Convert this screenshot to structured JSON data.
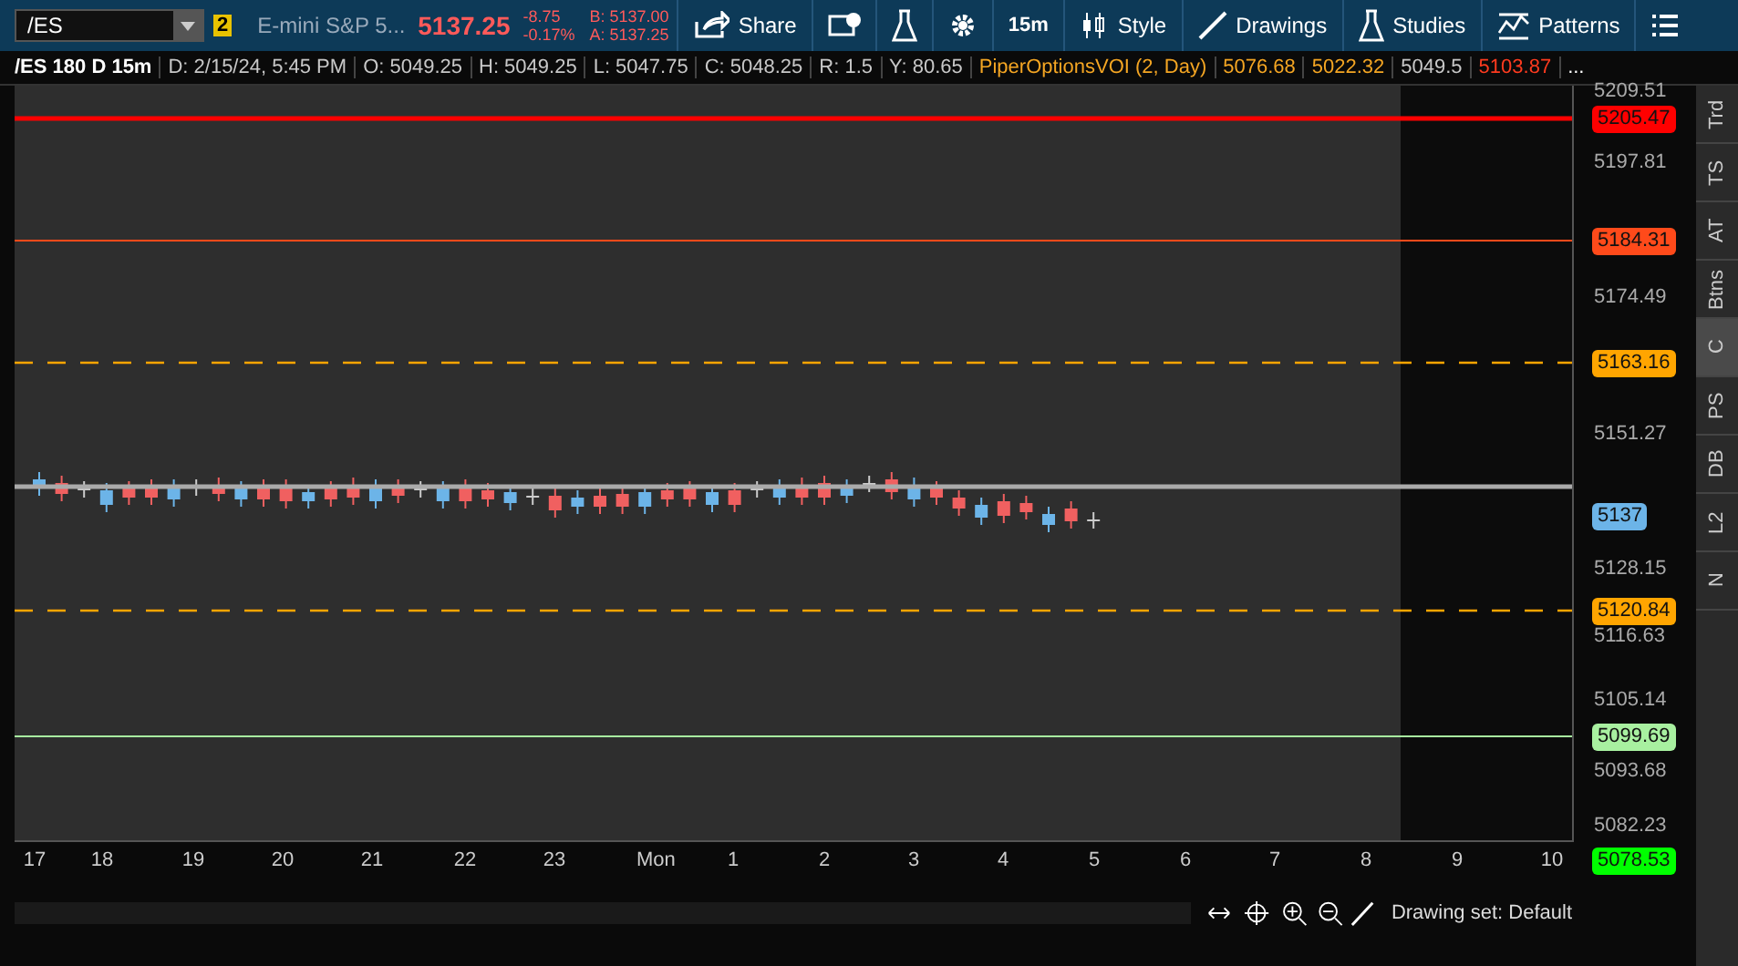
{
  "toolbar": {
    "symbol": "/ES",
    "link_badge": "2",
    "description": "E-mini S&P 5...",
    "last_price": "5137.25",
    "change": "-8.75",
    "change_pct": "-0.17%",
    "bid": "B: 5137.00",
    "ask": "A: 5137.25",
    "buttons": [
      {
        "kind": "share",
        "label": "Share"
      },
      {
        "kind": "monitor"
      },
      {
        "kind": "flask"
      },
      {
        "kind": "gear"
      },
      {
        "kind": "text",
        "label": "15m"
      },
      {
        "kind": "style",
        "label": "Style"
      },
      {
        "kind": "drawings",
        "label": "Drawings"
      },
      {
        "kind": "studies",
        "label": "Studies"
      },
      {
        "kind": "patterns",
        "label": "Patterns"
      },
      {
        "kind": "menu"
      }
    ]
  },
  "info_bar": {
    "title": "/ES 180 D 15m",
    "fields": [
      {
        "text": "D: 2/15/24, 5:45 PM",
        "color": "#c8c8c8"
      },
      {
        "text": "O: 5049.25",
        "color": "#c8c8c8"
      },
      {
        "text": "H: 5049.25",
        "color": "#c8c8c8"
      },
      {
        "text": "L: 5047.75",
        "color": "#c8c8c8"
      },
      {
        "text": "C: 5048.25",
        "color": "#c8c8c8"
      },
      {
        "text": "R: 1.5",
        "color": "#c8c8c8"
      },
      {
        "text": "Y: 80.65",
        "color": "#c8c8c8"
      },
      {
        "text": "PiperOptionsVOI (2, Day)",
        "color": "#f5a623"
      },
      {
        "text": "5076.68",
        "color": "#f5a623"
      },
      {
        "text": "5022.32",
        "color": "#f5a623"
      },
      {
        "text": "5049.5",
        "color": "#c8c8c8"
      },
      {
        "text": "5103.87",
        "color": "#ff3b1f"
      },
      {
        "text": "...",
        "color": "#ffffff"
      }
    ]
  },
  "price_axis": [
    "5209.51",
    "5197.81",
    "5174.49",
    "5151.27",
    "5128.15",
    "5116.63",
    "5105.14",
    "5093.68",
    "5082.23"
  ],
  "price_lines": [
    {
      "label": "5205.47",
      "color": "#ff0000",
      "kind": "solid"
    },
    {
      "label": "5184.31",
      "color": "#ff4a1a",
      "kind": "thin"
    },
    {
      "label": "5163.16",
      "color": "#ffa500",
      "kind": "dashed"
    },
    {
      "label": "5137",
      "color": "#6cb4e8",
      "kind": "price"
    },
    {
      "label": "5120.84",
      "color": "#ffa500",
      "kind": "dashed"
    },
    {
      "label": "5099.69",
      "color": "#a8f0a0",
      "kind": "thin"
    },
    {
      "label": "5078.53",
      "color": "#00ff00",
      "kind": "solid"
    }
  ],
  "time_axis": [
    "17",
    "18",
    "19",
    "20",
    "21",
    "22",
    "23",
    "Mon",
    "1",
    "2",
    "3",
    "4",
    "5",
    "6",
    "7",
    "8",
    "9",
    "10"
  ],
  "side_tabs": [
    {
      "label": "Trd",
      "selected": false
    },
    {
      "label": "TS",
      "selected": false
    },
    {
      "label": "AT",
      "selected": false
    },
    {
      "label": "Btns",
      "selected": false
    },
    {
      "label": "C",
      "selected": true
    },
    {
      "label": "PS",
      "selected": false
    },
    {
      "label": "DB",
      "selected": false
    },
    {
      "label": "L2",
      "selected": false
    },
    {
      "label": "N",
      "selected": false
    }
  ],
  "drawing_set": "Drawing set: Default"
}
